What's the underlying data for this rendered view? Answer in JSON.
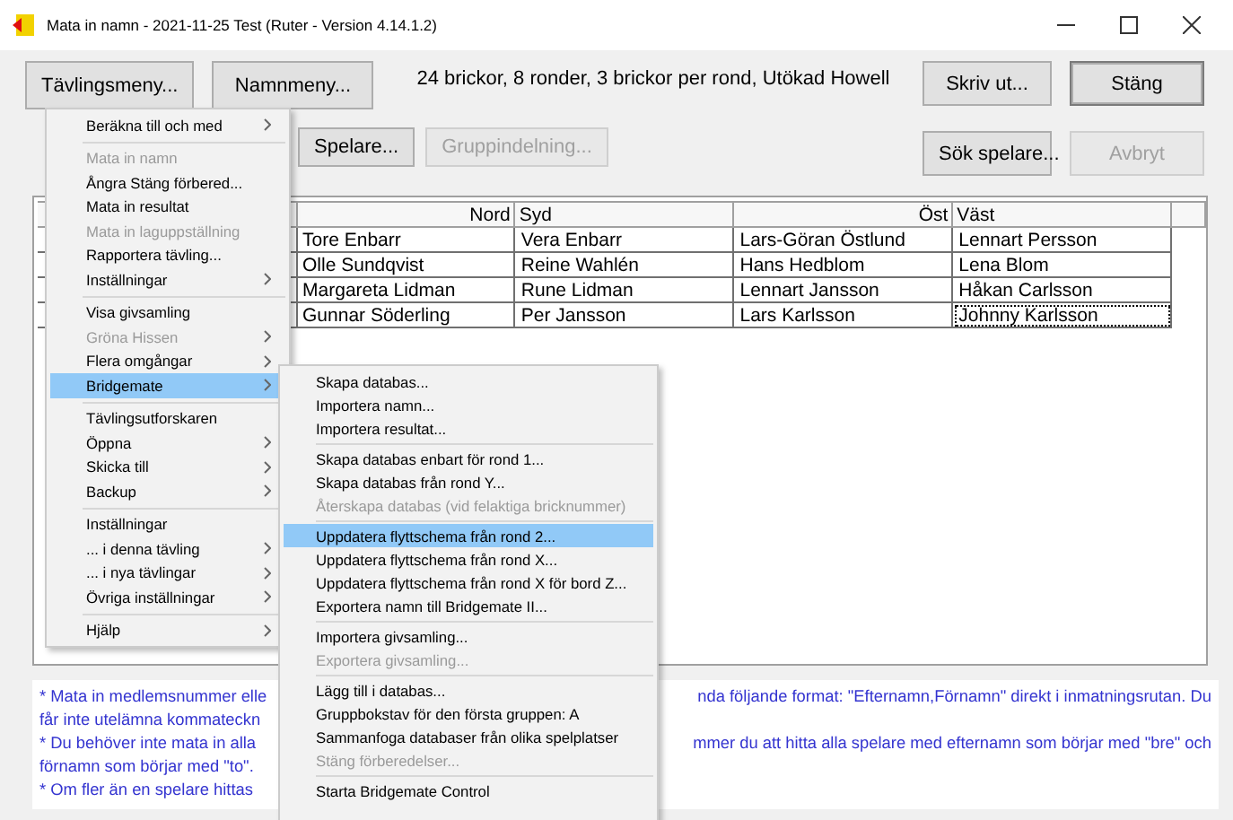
{
  "window": {
    "title": "Mata in namn - 2021-11-25  Test  (Ruter - Version 4.14.1.2)"
  },
  "toolbar": {
    "buttons": [
      {
        "label": "Tävlingsmeny...",
        "disabled": false
      },
      {
        "label": "Namnmeny...",
        "disabled": false
      }
    ],
    "info": "24 brickor, 8 ronder, 3 brickor per rond, Utökad Howell",
    "second_row": [
      {
        "label": "Spelare...",
        "disabled": false
      },
      {
        "label": "Gruppindelning...",
        "disabled": true
      }
    ],
    "right_buttons": [
      {
        "label": "Skriv ut...",
        "disabled": false
      },
      {
        "label": "Stäng",
        "disabled": false
      },
      {
        "label": "Sök spelare...",
        "disabled": false
      },
      {
        "label": "Avbryt",
        "disabled": true
      }
    ]
  },
  "table": {
    "columns": [
      {
        "label": "Nord"
      },
      {
        "label": "Syd"
      },
      {
        "label": "Öst"
      },
      {
        "label": "Väst"
      }
    ],
    "rows": [
      [
        {
          "text": "Tore Enbarr",
          "selected": false
        },
        {
          "text": "Vera Enbarr",
          "selected": false
        },
        {
          "text": "Lars-Göran Östlund",
          "selected": false
        },
        {
          "text": "Lennart Persson",
          "selected": false
        }
      ],
      [
        {
          "text": "Olle Sundqvist",
          "selected": false
        },
        {
          "text": "Reine Wahlén",
          "selected": false
        },
        {
          "text": "Hans Hedblom",
          "selected": false
        },
        {
          "text": "Lena Blom",
          "selected": false
        }
      ],
      [
        {
          "text": "Margareta Lidman",
          "selected": false
        },
        {
          "text": "Rune Lidman",
          "selected": false
        },
        {
          "text": "Lennart Jansson",
          "selected": false
        },
        {
          "text": "Håkan Carlsson",
          "selected": false
        }
      ],
      [
        {
          "text": "Gunnar Söderling",
          "selected": false
        },
        {
          "text": "Per Jansson",
          "selected": false
        },
        {
          "text": "Lars Karlsson",
          "selected": false
        },
        {
          "text": "Johnny Karlsson",
          "selected": true
        }
      ]
    ]
  },
  "notes": [
    {
      "left": "* Mata in medlemsnummer elle",
      "right": "nda följande format: \"Efternamn,Förnamn\" direkt i inmatningsrutan. Du"
    },
    {
      "left": "får inte utelämna kommateckn"
    },
    {
      "left": "* Du behöver inte mata in alla",
      "right": "mmer du att hitta alla spelare med efternamn som börjar med \"bre\" och"
    },
    {
      "left": "förnamn som börjar med \"to\"."
    },
    {
      "left": "* Om fler än en spelare hittas"
    }
  ],
  "menu": {
    "groups": [
      [
        {
          "label": "Beräkna till och med",
          "disabled": false,
          "submenu": true,
          "selected": false
        }
      ],
      [
        {
          "label": "Mata in namn",
          "disabled": true,
          "submenu": false,
          "selected": false
        },
        {
          "label": "Ångra Stäng förbered...",
          "disabled": false,
          "submenu": false,
          "selected": false
        },
        {
          "label": "Mata in resultat",
          "disabled": false,
          "submenu": false,
          "selected": false
        },
        {
          "label": "Mata in laguppställning",
          "disabled": true,
          "submenu": false,
          "selected": false
        },
        {
          "label": "Rapportera tävling...",
          "disabled": false,
          "submenu": false,
          "selected": false
        },
        {
          "label": "Inställningar",
          "disabled": false,
          "submenu": true,
          "selected": false
        }
      ],
      [
        {
          "label": "Visa givsamling",
          "disabled": false,
          "submenu": false,
          "selected": false
        },
        {
          "label": "Gröna Hissen",
          "disabled": true,
          "submenu": true,
          "selected": false
        },
        {
          "label": "Flera omgångar",
          "disabled": false,
          "submenu": true,
          "selected": false
        },
        {
          "label": "Bridgemate",
          "disabled": false,
          "submenu": true,
          "selected": true
        }
      ],
      [
        {
          "label": "Tävlingsutforskaren",
          "disabled": false,
          "submenu": false,
          "selected": false
        },
        {
          "label": "Öppna",
          "disabled": false,
          "submenu": true,
          "selected": false
        },
        {
          "label": "Skicka till",
          "disabled": false,
          "submenu": true,
          "selected": false
        },
        {
          "label": "Backup",
          "disabled": false,
          "submenu": true,
          "selected": false
        }
      ],
      [
        {
          "label": "Inställningar",
          "disabled": false,
          "submenu": false,
          "selected": false
        },
        {
          "label": "... i denna tävling",
          "disabled": false,
          "submenu": true,
          "selected": false
        },
        {
          "label": "... i nya tävlingar",
          "disabled": false,
          "submenu": true,
          "selected": false
        },
        {
          "label": "Övriga inställningar",
          "disabled": false,
          "submenu": true,
          "selected": false
        }
      ],
      [
        {
          "label": "Hjälp",
          "disabled": false,
          "submenu": true,
          "selected": false
        }
      ]
    ]
  },
  "submenu": {
    "groups": [
      [
        {
          "label": "Skapa databas...",
          "disabled": false,
          "selected": false
        },
        {
          "label": "Importera namn...",
          "disabled": false,
          "selected": false
        },
        {
          "label": "Importera resultat...",
          "disabled": false,
          "selected": false
        }
      ],
      [
        {
          "label": "Skapa databas enbart för rond 1...",
          "disabled": false,
          "selected": false
        },
        {
          "label": "Skapa databas från rond Y...",
          "disabled": false,
          "selected": false
        },
        {
          "label": "Återskapa databas (vid felaktiga bricknummer)",
          "disabled": true,
          "selected": false
        }
      ],
      [
        {
          "label": "Uppdatera flyttschema från rond 2...",
          "disabled": false,
          "selected": true
        },
        {
          "label": "Uppdatera flyttschema från rond X...",
          "disabled": false,
          "selected": false
        },
        {
          "label": "Uppdatera flyttschema från rond X för bord Z...",
          "disabled": false,
          "selected": false
        },
        {
          "label": "Exportera namn till Bridgemate II...",
          "disabled": false,
          "selected": false
        }
      ],
      [
        {
          "label": "Importera givsamling...",
          "disabled": false,
          "selected": false
        },
        {
          "label": "Exportera givsamling...",
          "disabled": true,
          "selected": false
        }
      ],
      [
        {
          "label": "Lägg till i databas...",
          "disabled": false,
          "selected": false
        },
        {
          "label": "Gruppbokstav för den första gruppen:  A",
          "disabled": false,
          "selected": false
        },
        {
          "label": "Sammanfoga databaser från olika spelplatser",
          "disabled": false,
          "selected": false
        },
        {
          "label": "Stäng förberedelser...",
          "disabled": true,
          "selected": false
        }
      ],
      [
        {
          "label": "Starta Bridgemate Control",
          "disabled": false,
          "selected": false
        }
      ]
    ]
  }
}
